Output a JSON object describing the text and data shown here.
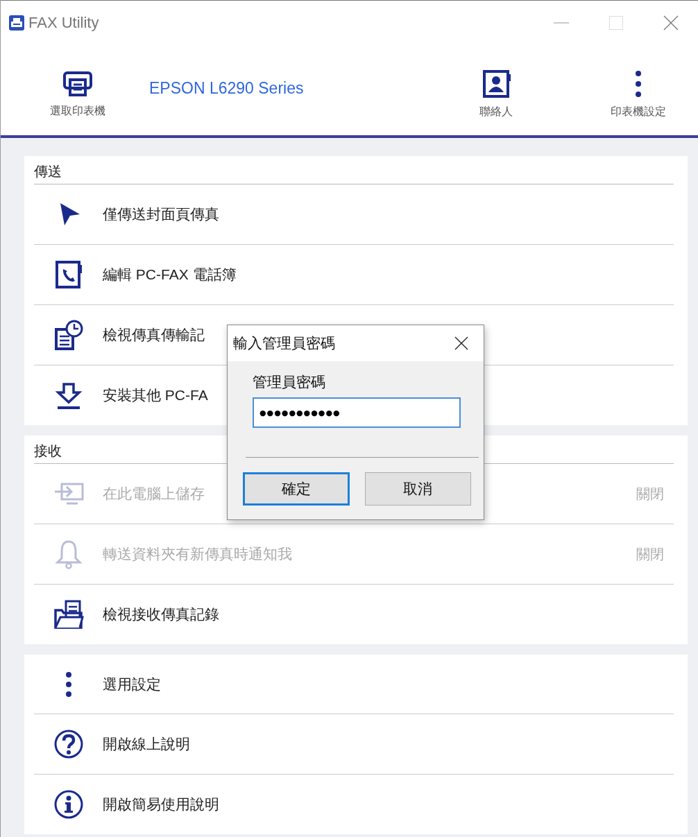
{
  "window": {
    "title": "FAX Utility"
  },
  "toolbar": {
    "select_printer": "選取印表機",
    "printer_name": "EPSON L6290 Series",
    "contacts": "聯絡人",
    "printer_settings": "印表機設定"
  },
  "sections": [
    {
      "title": "傳送",
      "items": [
        {
          "label": "僅傳送封面頁傳真",
          "disabled": false
        },
        {
          "label": "編輯 PC-FAX 電話簿",
          "disabled": false
        },
        {
          "label": "檢視傳真傳輸記",
          "disabled": false
        },
        {
          "label": "安裝其他 PC-FA",
          "disabled": false
        }
      ]
    },
    {
      "title": "接收",
      "items": [
        {
          "label": "在此電腦上儲存",
          "disabled": true,
          "value": "關閉"
        },
        {
          "label": "轉送資料夾有新傳真時通知我",
          "disabled": true,
          "value": "關閉"
        },
        {
          "label": "檢視接收傳真記錄",
          "disabled": false
        }
      ]
    },
    {
      "items": [
        {
          "label": "選用設定",
          "disabled": false
        },
        {
          "label": "開啟線上說明",
          "disabled": false
        },
        {
          "label": "開啟簡易使用說明",
          "disabled": false
        }
      ]
    }
  ],
  "dialog": {
    "title": "輸入管理員密碼",
    "field_label": "管理員密碼",
    "password": "●●●●●●●●●●●",
    "buttons": [
      {
        "label": "確定",
        "selected": true
      },
      {
        "label": "取消",
        "selected": false
      }
    ]
  }
}
